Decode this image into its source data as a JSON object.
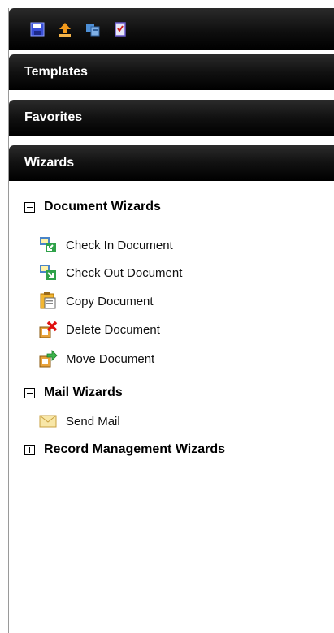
{
  "toolbar": {
    "buttons": [
      {
        "name": "save-icon"
      },
      {
        "name": "upload-icon"
      },
      {
        "name": "scan-icon"
      },
      {
        "name": "checklist-icon"
      }
    ]
  },
  "sections": {
    "templates": "Templates",
    "favorites": "Favorites",
    "wizards": "Wizards"
  },
  "tree": {
    "document_wizards": {
      "label": "Document Wizards",
      "expanded": true,
      "items": [
        {
          "label": "Check In Document",
          "icon": "check-in-icon"
        },
        {
          "label": "Check Out Document",
          "icon": "check-out-icon"
        },
        {
          "label": "Copy Document",
          "icon": "copy-document-icon"
        },
        {
          "label": "Delete Document",
          "icon": "delete-document-icon"
        },
        {
          "label": "Move Document",
          "icon": "move-document-icon"
        }
      ]
    },
    "mail_wizards": {
      "label": "Mail Wizards",
      "expanded": true,
      "items": [
        {
          "label": "Send Mail",
          "icon": "envelope-icon"
        }
      ]
    },
    "record_management_wizards": {
      "label": "Record Management Wizards",
      "expanded": false
    }
  }
}
